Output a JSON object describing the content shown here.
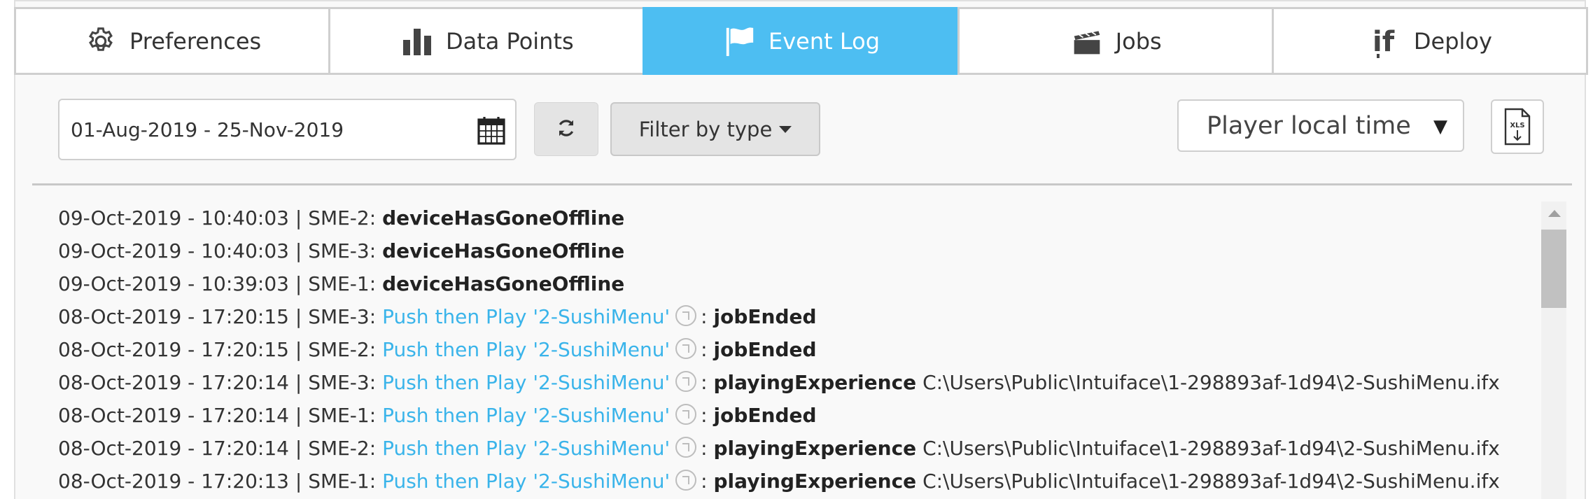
{
  "tabs": [
    {
      "label": "Preferences",
      "icon": "gear-icon"
    },
    {
      "label": "Data Points",
      "icon": "bar-chart-icon"
    },
    {
      "label": "Event Log",
      "icon": "flag-icon",
      "active": true
    },
    {
      "label": "Jobs",
      "icon": "clapperboard-icon"
    },
    {
      "label": "Deploy",
      "icon": "deploy-icon"
    }
  ],
  "toolbar": {
    "date_range": "01-Aug-2019 - 25-Nov-2019",
    "filter_label": "Filter by type",
    "timezone": "Player local time",
    "export_label": "XLS"
  },
  "log": [
    {
      "timestamp": "09-Oct-2019 - 10:40:03",
      "source": "SME-2",
      "job": "",
      "event": "deviceHasGoneOffline",
      "detail": ""
    },
    {
      "timestamp": "09-Oct-2019 - 10:40:03",
      "source": "SME-3",
      "job": "",
      "event": "deviceHasGoneOffline",
      "detail": ""
    },
    {
      "timestamp": "09-Oct-2019 - 10:39:03",
      "source": "SME-1",
      "job": "",
      "event": "deviceHasGoneOffline",
      "detail": ""
    },
    {
      "timestamp": "08-Oct-2019 - 17:20:15",
      "source": "SME-3",
      "job": "Push then Play '2-SushiMenu'",
      "event": "jobEnded",
      "detail": ""
    },
    {
      "timestamp": "08-Oct-2019 - 17:20:15",
      "source": "SME-2",
      "job": "Push then Play '2-SushiMenu'",
      "event": "jobEnded",
      "detail": ""
    },
    {
      "timestamp": "08-Oct-2019 - 17:20:14",
      "source": "SME-3",
      "job": "Push then Play '2-SushiMenu'",
      "event": "playingExperience",
      "detail": "C:\\Users\\Public\\Intuiface\\1-298893af-1d94\\2-SushiMenu.ifx"
    },
    {
      "timestamp": "08-Oct-2019 - 17:20:14",
      "source": "SME-1",
      "job": "Push then Play '2-SushiMenu'",
      "event": "jobEnded",
      "detail": ""
    },
    {
      "timestamp": "08-Oct-2019 - 17:20:14",
      "source": "SME-2",
      "job": "Push then Play '2-SushiMenu'",
      "event": "playingExperience",
      "detail": "C:\\Users\\Public\\Intuiface\\1-298893af-1d94\\2-SushiMenu.ifx"
    },
    {
      "timestamp": "08-Oct-2019 - 17:20:13",
      "source": "SME-1",
      "job": "Push then Play '2-SushiMenu'",
      "event": "playingExperience",
      "detail": "C:\\Users\\Public\\Intuiface\\1-298893af-1d94\\2-SushiMenu.ifx"
    }
  ],
  "colors": {
    "accent": "#4dbef2",
    "link": "#3ab4ea"
  }
}
